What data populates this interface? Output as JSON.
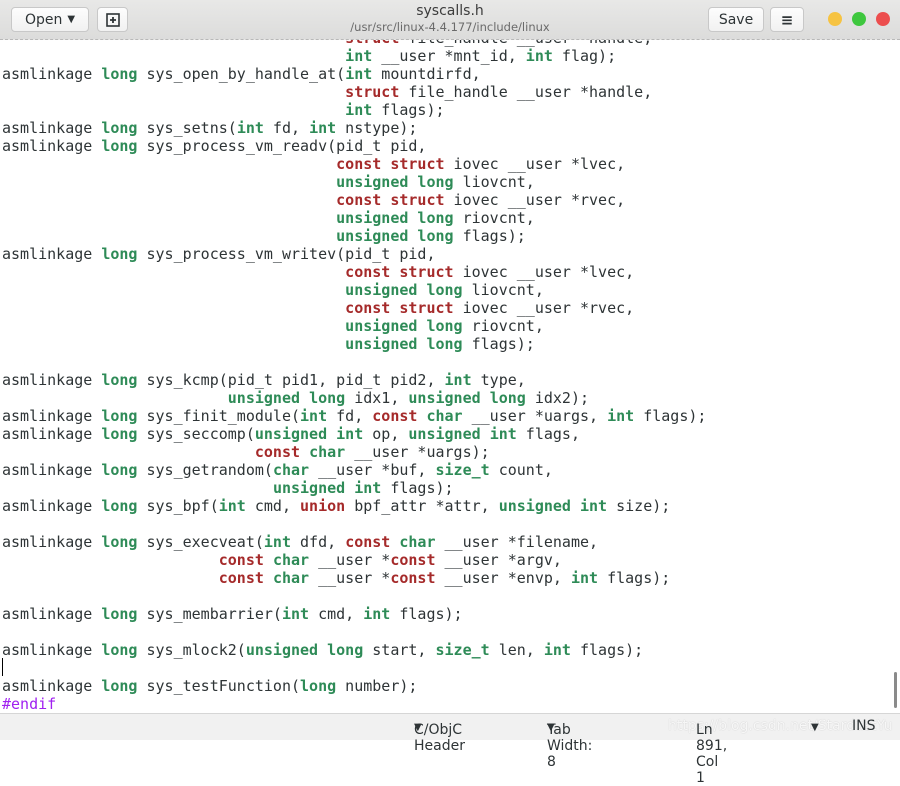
{
  "header": {
    "open_label": "Open",
    "title": "syscalls.h",
    "subtitle": "/usr/src/linux-4.4.177/include/linux",
    "save_label": "Save"
  },
  "window_controls": {
    "minimize": "#f6c342",
    "maximize": "#3ec73e",
    "close": "#ec4e4e"
  },
  "syntax_colors": {
    "type": "#2e8b57",
    "keyword": "#a52a2a",
    "preprocessor": "#a020f0"
  },
  "code_lines": [
    [
      [
        "                                      ",
        "n"
      ],
      [
        "struct",
        "k"
      ],
      [
        " file_handle __user *handle,",
        "n"
      ]
    ],
    [
      [
        "                                      ",
        "n"
      ],
      [
        "int",
        "t"
      ],
      [
        " __user *mnt_id, ",
        "n"
      ],
      [
        "int",
        "t"
      ],
      [
        " flag);",
        "n"
      ]
    ],
    [
      [
        "asmlinkage ",
        "n"
      ],
      [
        "long",
        "t"
      ],
      [
        " sys_open_by_handle_at(",
        "n"
      ],
      [
        "int",
        "t"
      ],
      [
        " mountdirfd,",
        "n"
      ]
    ],
    [
      [
        "                                      ",
        "n"
      ],
      [
        "struct",
        "k"
      ],
      [
        " file_handle __user *handle,",
        "n"
      ]
    ],
    [
      [
        "                                      ",
        "n"
      ],
      [
        "int",
        "t"
      ],
      [
        " flags);",
        "n"
      ]
    ],
    [
      [
        "asmlinkage ",
        "n"
      ],
      [
        "long",
        "t"
      ],
      [
        " sys_setns(",
        "n"
      ],
      [
        "int",
        "t"
      ],
      [
        " fd, ",
        "n"
      ],
      [
        "int",
        "t"
      ],
      [
        " nstype);",
        "n"
      ]
    ],
    [
      [
        "asmlinkage ",
        "n"
      ],
      [
        "long",
        "t"
      ],
      [
        " sys_process_vm_readv(pid_t pid,",
        "n"
      ]
    ],
    [
      [
        "                                     ",
        "n"
      ],
      [
        "const",
        "k"
      ],
      [
        " ",
        "n"
      ],
      [
        "struct",
        "k"
      ],
      [
        " iovec __user *lvec,",
        "n"
      ]
    ],
    [
      [
        "                                     ",
        "n"
      ],
      [
        "unsigned",
        "t"
      ],
      [
        " ",
        "n"
      ],
      [
        "long",
        "t"
      ],
      [
        " liovcnt,",
        "n"
      ]
    ],
    [
      [
        "                                     ",
        "n"
      ],
      [
        "const",
        "k"
      ],
      [
        " ",
        "n"
      ],
      [
        "struct",
        "k"
      ],
      [
        " iovec __user *rvec,",
        "n"
      ]
    ],
    [
      [
        "                                     ",
        "n"
      ],
      [
        "unsigned",
        "t"
      ],
      [
        " ",
        "n"
      ],
      [
        "long",
        "t"
      ],
      [
        " riovcnt,",
        "n"
      ]
    ],
    [
      [
        "                                     ",
        "n"
      ],
      [
        "unsigned",
        "t"
      ],
      [
        " ",
        "n"
      ],
      [
        "long",
        "t"
      ],
      [
        " flags);",
        "n"
      ]
    ],
    [
      [
        "asmlinkage ",
        "n"
      ],
      [
        "long",
        "t"
      ],
      [
        " sys_process_vm_writev(pid_t pid,",
        "n"
      ]
    ],
    [
      [
        "                                      ",
        "n"
      ],
      [
        "const",
        "k"
      ],
      [
        " ",
        "n"
      ],
      [
        "struct",
        "k"
      ],
      [
        " iovec __user *lvec,",
        "n"
      ]
    ],
    [
      [
        "                                      ",
        "n"
      ],
      [
        "unsigned",
        "t"
      ],
      [
        " ",
        "n"
      ],
      [
        "long",
        "t"
      ],
      [
        " liovcnt,",
        "n"
      ]
    ],
    [
      [
        "                                      ",
        "n"
      ],
      [
        "const",
        "k"
      ],
      [
        " ",
        "n"
      ],
      [
        "struct",
        "k"
      ],
      [
        " iovec __user *rvec,",
        "n"
      ]
    ],
    [
      [
        "                                      ",
        "n"
      ],
      [
        "unsigned",
        "t"
      ],
      [
        " ",
        "n"
      ],
      [
        "long",
        "t"
      ],
      [
        " riovcnt,",
        "n"
      ]
    ],
    [
      [
        "                                      ",
        "n"
      ],
      [
        "unsigned",
        "t"
      ],
      [
        " ",
        "n"
      ],
      [
        "long",
        "t"
      ],
      [
        " flags);",
        "n"
      ]
    ],
    [],
    [
      [
        "asmlinkage ",
        "n"
      ],
      [
        "long",
        "t"
      ],
      [
        " sys_kcmp(pid_t pid1, pid_t pid2, ",
        "n"
      ],
      [
        "int",
        "t"
      ],
      [
        " type,",
        "n"
      ]
    ],
    [
      [
        "                         ",
        "n"
      ],
      [
        "unsigned",
        "t"
      ],
      [
        " ",
        "n"
      ],
      [
        "long",
        "t"
      ],
      [
        " idx1, ",
        "n"
      ],
      [
        "unsigned",
        "t"
      ],
      [
        " ",
        "n"
      ],
      [
        "long",
        "t"
      ],
      [
        " idx2);",
        "n"
      ]
    ],
    [
      [
        "asmlinkage ",
        "n"
      ],
      [
        "long",
        "t"
      ],
      [
        " sys_finit_module(",
        "n"
      ],
      [
        "int",
        "t"
      ],
      [
        " fd, ",
        "n"
      ],
      [
        "const",
        "k"
      ],
      [
        " ",
        "n"
      ],
      [
        "char",
        "t"
      ],
      [
        " __user *uargs, ",
        "n"
      ],
      [
        "int",
        "t"
      ],
      [
        " flags);",
        "n"
      ]
    ],
    [
      [
        "asmlinkage ",
        "n"
      ],
      [
        "long",
        "t"
      ],
      [
        " sys_seccomp(",
        "n"
      ],
      [
        "unsigned",
        "t"
      ],
      [
        " ",
        "n"
      ],
      [
        "int",
        "t"
      ],
      [
        " op, ",
        "n"
      ],
      [
        "unsigned",
        "t"
      ],
      [
        " ",
        "n"
      ],
      [
        "int",
        "t"
      ],
      [
        " flags,",
        "n"
      ]
    ],
    [
      [
        "                            ",
        "n"
      ],
      [
        "const",
        "k"
      ],
      [
        " ",
        "n"
      ],
      [
        "char",
        "t"
      ],
      [
        " __user *uargs);",
        "n"
      ]
    ],
    [
      [
        "asmlinkage ",
        "n"
      ],
      [
        "long",
        "t"
      ],
      [
        " sys_getrandom(",
        "n"
      ],
      [
        "char",
        "t"
      ],
      [
        " __user *buf, ",
        "n"
      ],
      [
        "size_t",
        "t"
      ],
      [
        " count,",
        "n"
      ]
    ],
    [
      [
        "                              ",
        "n"
      ],
      [
        "unsigned",
        "t"
      ],
      [
        " ",
        "n"
      ],
      [
        "int",
        "t"
      ],
      [
        " flags);",
        "n"
      ]
    ],
    [
      [
        "asmlinkage ",
        "n"
      ],
      [
        "long",
        "t"
      ],
      [
        " sys_bpf(",
        "n"
      ],
      [
        "int",
        "t"
      ],
      [
        " cmd, ",
        "n"
      ],
      [
        "union",
        "k"
      ],
      [
        " bpf_attr *attr, ",
        "n"
      ],
      [
        "unsigned",
        "t"
      ],
      [
        " ",
        "n"
      ],
      [
        "int",
        "t"
      ],
      [
        " size);",
        "n"
      ]
    ],
    [],
    [
      [
        "asmlinkage ",
        "n"
      ],
      [
        "long",
        "t"
      ],
      [
        " sys_execveat(",
        "n"
      ],
      [
        "int",
        "t"
      ],
      [
        " dfd, ",
        "n"
      ],
      [
        "const",
        "k"
      ],
      [
        " ",
        "n"
      ],
      [
        "char",
        "t"
      ],
      [
        " __user *filename,",
        "n"
      ]
    ],
    [
      [
        "                        ",
        "n"
      ],
      [
        "const",
        "k"
      ],
      [
        " ",
        "n"
      ],
      [
        "char",
        "t"
      ],
      [
        " __user *",
        "n"
      ],
      [
        "const",
        "k"
      ],
      [
        " __user *argv,",
        "n"
      ]
    ],
    [
      [
        "                        ",
        "n"
      ],
      [
        "const",
        "k"
      ],
      [
        " ",
        "n"
      ],
      [
        "char",
        "t"
      ],
      [
        " __user *",
        "n"
      ],
      [
        "const",
        "k"
      ],
      [
        " __user *envp, ",
        "n"
      ],
      [
        "int",
        "t"
      ],
      [
        " flags);",
        "n"
      ]
    ],
    [],
    [
      [
        "asmlinkage ",
        "n"
      ],
      [
        "long",
        "t"
      ],
      [
        " sys_membarrier(",
        "n"
      ],
      [
        "int",
        "t"
      ],
      [
        " cmd, ",
        "n"
      ],
      [
        "int",
        "t"
      ],
      [
        " flags);",
        "n"
      ]
    ],
    [],
    [
      [
        "asmlinkage ",
        "n"
      ],
      [
        "long",
        "t"
      ],
      [
        " sys_mlock2(",
        "n"
      ],
      [
        "unsigned",
        "t"
      ],
      [
        " ",
        "n"
      ],
      [
        "long",
        "t"
      ],
      [
        " start, ",
        "n"
      ],
      [
        "size_t",
        "t"
      ],
      [
        " len, ",
        "n"
      ],
      [
        "int",
        "t"
      ],
      [
        " flags);",
        "n"
      ]
    ],
    [],
    [
      [
        "asmlinkage ",
        "n"
      ],
      [
        "long",
        "t"
      ],
      [
        " sys_testFunction(",
        "n"
      ],
      [
        "long",
        "t"
      ],
      [
        " number);",
        "n"
      ]
    ],
    [
      [
        "#endif",
        "p"
      ]
    ]
  ],
  "status": {
    "language": "C/ObjC Header",
    "tab_width": "Tab Width: 8",
    "position": "Ln 891, Col 1",
    "mode": "INS",
    "watermark": "https://blog.csdn.net/StardustYu"
  }
}
